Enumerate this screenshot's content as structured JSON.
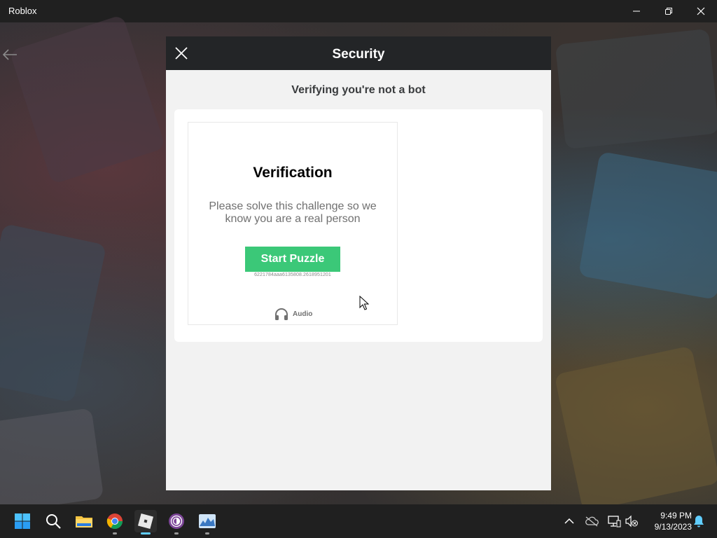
{
  "window": {
    "title": "Roblox",
    "buttons": [
      "minimize",
      "restore",
      "close"
    ]
  },
  "modal": {
    "title": "Security",
    "subtitle": "Verifying you're not a bot",
    "captcha": {
      "title": "Verification",
      "description": "Please solve this challenge so we know you are a real person",
      "start_label": "Start Puzzle",
      "session_id": "6221784aaa6135808.2618951201",
      "audio_label": "Audio"
    }
  },
  "taskbar": {
    "apps": [
      "start-icon",
      "search-icon",
      "file-explorer-icon",
      "chrome-icon",
      "roblox-icon",
      "tor-browser-icon",
      "photos-icon"
    ],
    "clock": {
      "time": "9:49 PM",
      "date": "9/13/2023"
    }
  },
  "colors": {
    "accent_green": "#3bc878",
    "header_dark": "#232527",
    "taskbar_active": "#60cdff"
  }
}
